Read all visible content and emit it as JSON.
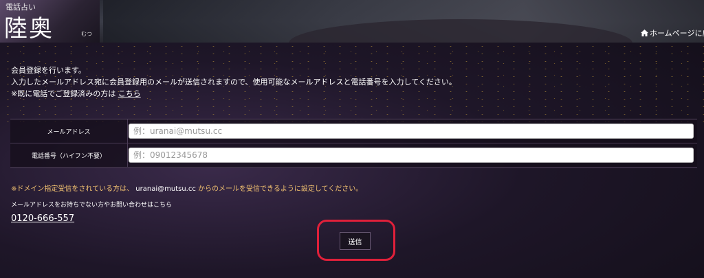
{
  "header": {
    "logo_small": "電話占い",
    "logo_big": "陸奥",
    "logo_kana": "むつ",
    "home_link": "ホームページに戻る"
  },
  "intro": {
    "line1": "会員登録を行います。",
    "line2": "入力したメールアドレス宛に会員登録用のメールが送信されますので、使用可能なメールアドレスと電話番号を入力してください。",
    "line3_prefix": "※既に電話でご登録済みの方は",
    "line3_link": "こちら"
  },
  "form": {
    "email_label": "メールアドレス",
    "email_placeholder": "例：uranai@mutsu.cc",
    "phone_label": "電話番号（ハイフン不要）",
    "phone_placeholder": "例：09012345678"
  },
  "note": {
    "prefix": "※ドメイン指定受信をされている方は、",
    "domain": "uranai@mutsu.cc",
    "suffix": "からのメールを受信できるように設定してください。"
  },
  "inquiry": {
    "text": "メールアドレスをお持ちでない方やお問い合わせはこちら",
    "phone": "0120-666-557"
  },
  "submit_label": "送信",
  "colors": {
    "note": "#f0c070",
    "highlight": "#e0203a"
  },
  "icons": {
    "home": "home-icon"
  }
}
